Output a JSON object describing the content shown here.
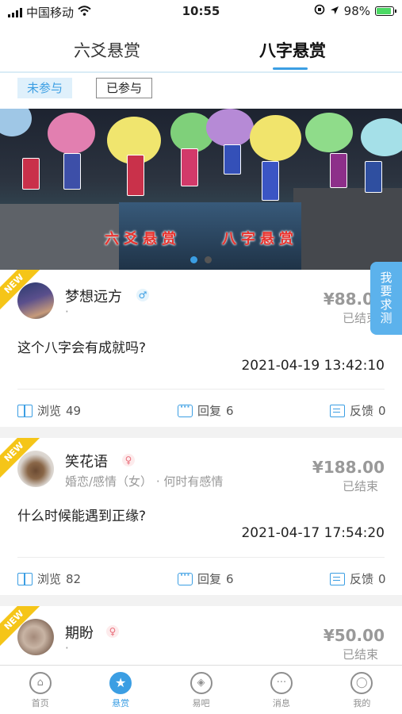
{
  "status_bar": {
    "carrier": "中国移动",
    "time": "10:55",
    "battery": "98%",
    "battery_level": 0.98,
    "icons": [
      "signal-icon",
      "wifi-icon",
      "location-icon",
      "battery-icon"
    ]
  },
  "tabs": [
    {
      "label": "六爻悬赏",
      "active": false
    },
    {
      "label": "八字悬赏",
      "active": true
    }
  ],
  "filters": [
    {
      "label": "未参与",
      "active": true
    },
    {
      "label": "已参与",
      "active": false
    }
  ],
  "banner": {
    "text_left": "六爻悬赏",
    "text_right": "八字悬赏",
    "slide_count": 2,
    "current_slide": 1
  },
  "float_button": {
    "label": "我要求测"
  },
  "posts": [
    {
      "badge": "NEW",
      "username": "梦想远方",
      "gender": "♂",
      "subline": "·",
      "price": "¥88.00",
      "status": "已结束",
      "question": "这个八字会有成就吗?",
      "datetime": "2021-04-19 13:42:10",
      "views_label": "浏览",
      "views": "49",
      "replies_label": "回复",
      "replies": "6",
      "feedback_label": "反馈",
      "feedback": "0"
    },
    {
      "badge": "NEW",
      "username": "笑花语",
      "gender": "♀",
      "subline": "婚恋/感情（女） · 何时有感情",
      "price": "¥188.00",
      "status": "已结束",
      "question": "什么时候能遇到正缘?",
      "datetime": "2021-04-17 17:54:20",
      "views_label": "浏览",
      "views": "82",
      "replies_label": "回复",
      "replies": "6",
      "feedback_label": "反馈",
      "feedback": "0"
    },
    {
      "badge": "NEW",
      "username": "期盼",
      "gender": "♀",
      "subline": "·",
      "price": "¥50.00",
      "status": "已结束"
    }
  ],
  "bottom_nav": [
    {
      "label": "首页",
      "icon": "home-icon",
      "glyph": "⌂",
      "active": false
    },
    {
      "label": "悬赏",
      "icon": "star-icon",
      "glyph": "★",
      "active": true
    },
    {
      "label": "易吧",
      "icon": "compass-icon",
      "glyph": "◈",
      "active": false
    },
    {
      "label": "消息",
      "icon": "message-icon",
      "glyph": "···",
      "active": false
    },
    {
      "label": "我的",
      "icon": "profile-icon",
      "glyph": "◯",
      "active": false
    }
  ],
  "colors": {
    "accent": "#3b9ee3",
    "badge": "#f5c518",
    "female": "#e96f7c",
    "banner_text": "#e8332e"
  }
}
